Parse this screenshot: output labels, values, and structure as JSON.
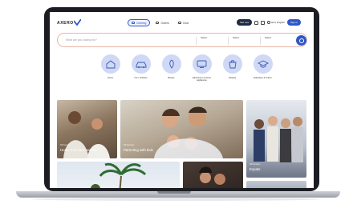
{
  "header": {
    "logo": "AXERO",
    "tabs": [
      {
        "label": "Clothing",
        "active": true
      },
      {
        "label": "Orders",
        "active": false
      },
      {
        "label": "Chat",
        "active": false
      }
    ],
    "sell_button": "Sell now",
    "language": "EN | English",
    "signin_button": "Sign in"
  },
  "search": {
    "placeholder": "What are you looking for?",
    "filters": [
      {
        "label": "",
        "value": "Select"
      },
      {
        "label": "",
        "value": "Select"
      },
      {
        "label": "",
        "value": "Select"
      }
    ]
  },
  "categories": [
    {
      "label": "Home",
      "icon": "home-icon"
    },
    {
      "label": "Car / Vehicles",
      "icon": "car-icon"
    },
    {
      "label": "Beauty",
      "icon": "beauty-icon"
    },
    {
      "label": "Electronics & Home appliances",
      "icon": "appliance-icon"
    },
    {
      "label": "Lifestyle",
      "icon": "lifestyle-icon"
    },
    {
      "label": "Education & Tuition",
      "icon": "education-icon"
    }
  ],
  "cards": [
    {
      "caption": "NR Services",
      "title": "Home and care owners"
    },
    {
      "caption": "NR Services",
      "title": "Parenting with kids"
    },
    {
      "caption": "NR Services",
      "title": "Expats"
    }
  ],
  "colors": {
    "accent": "#2d57c9",
    "frame": "#1c1d22",
    "category_bg": "#cfd9f6",
    "search_border": "#e8b7a6"
  }
}
